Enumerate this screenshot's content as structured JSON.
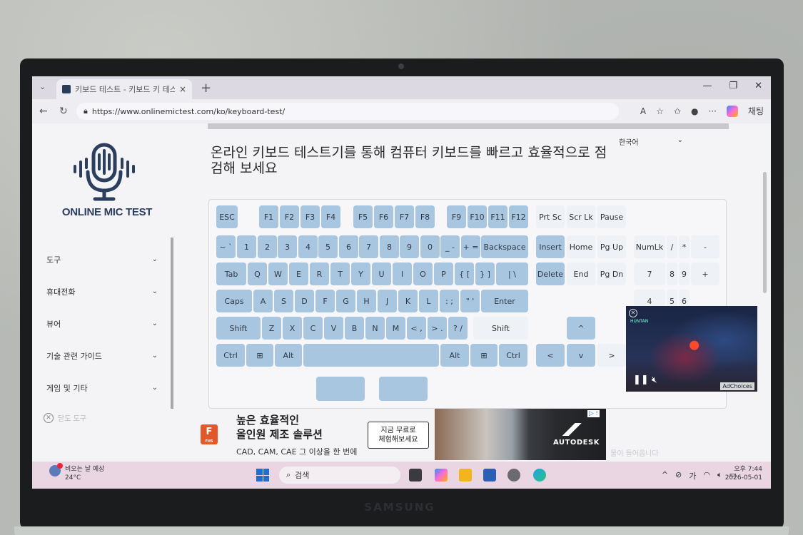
{
  "browser": {
    "tab_title": "키보드 테스트 - 키보드 키 테스트",
    "tab_close": "×",
    "new_tab": "+",
    "url": "https://www.onlinemictest.com/ko/keyboard-test/",
    "copilot_label": "채팅"
  },
  "site": {
    "logo_text": "ONLINE MIC TEST",
    "language": "한국어",
    "headline": "온라인 키보드 테스트기를 통해 컴퓨터 키보드를 빠르고 효율적으로 점검해 보세요"
  },
  "sidebar": {
    "items": [
      {
        "label": "도구"
      },
      {
        "label": "휴대전화"
      },
      {
        "label": "뷰어"
      },
      {
        "label": "기술 관련 가이드"
      },
      {
        "label": "게임 및 기타"
      }
    ],
    "close_label": "닫도 도구"
  },
  "keyboard": {
    "keys": [
      {
        "label": "ESC",
        "row": 0
      },
      {
        "label": "F1",
        "row": 0
      },
      {
        "label": "F2",
        "row": 0
      },
      {
        "label": "F3",
        "row": 0
      },
      {
        "label": "F4",
        "row": 0
      },
      {
        "label": "F5",
        "row": 0
      },
      {
        "label": "F6",
        "row": 0
      },
      {
        "label": "F7",
        "row": 0
      },
      {
        "label": "F8",
        "row": 0
      },
      {
        "label": "F9",
        "row": 0
      },
      {
        "label": "F10",
        "row": 0
      },
      {
        "label": "F11",
        "row": 0
      },
      {
        "label": "F12",
        "row": 0
      },
      {
        "label": "Prt Sc",
        "row": 0
      },
      {
        "label": "Scr Lk",
        "row": 0
      },
      {
        "label": "Pause",
        "row": 0
      },
      {
        "label": "~ `",
        "row": 1
      },
      {
        "label": "1",
        "row": 1
      },
      {
        "label": "2",
        "row": 1
      },
      {
        "label": "3",
        "row": 1
      },
      {
        "label": "4",
        "row": 1
      },
      {
        "label": "5",
        "row": 1
      },
      {
        "label": "6",
        "row": 1
      },
      {
        "label": "7",
        "row": 1
      },
      {
        "label": "8",
        "row": 1
      },
      {
        "label": "9",
        "row": 1
      },
      {
        "label": "0",
        "row": 1
      },
      {
        "label": "_ -",
        "row": 1
      },
      {
        "label": "+ =",
        "row": 1
      },
      {
        "label": "Backspace",
        "row": 1
      },
      {
        "label": "Insert",
        "row": 1
      },
      {
        "label": "Home",
        "row": 1
      },
      {
        "label": "Pg Up",
        "row": 1
      },
      {
        "label": "NumLk",
        "row": 1
      },
      {
        "label": "/",
        "row": 1
      },
      {
        "label": "*",
        "row": 1
      },
      {
        "label": "-",
        "row": 1
      },
      {
        "label": "Tab",
        "row": 2
      },
      {
        "label": "Q",
        "row": 2
      },
      {
        "label": "W",
        "row": 2
      },
      {
        "label": "E",
        "row": 2
      },
      {
        "label": "R",
        "row": 2
      },
      {
        "label": "T",
        "row": 2
      },
      {
        "label": "Y",
        "row": 2
      },
      {
        "label": "U",
        "row": 2
      },
      {
        "label": "I",
        "row": 2
      },
      {
        "label": "O",
        "row": 2
      },
      {
        "label": "P",
        "row": 2
      },
      {
        "label": "{ [",
        "row": 2
      },
      {
        "label": "} ]",
        "row": 2
      },
      {
        "label": "| \\",
        "row": 2
      },
      {
        "label": "Delete",
        "row": 2
      },
      {
        "label": "End",
        "row": 2
      },
      {
        "label": "Pg Dn",
        "row": 2
      },
      {
        "label": "7",
        "row": 2
      },
      {
        "label": "8",
        "row": 2
      },
      {
        "label": "9",
        "row": 2
      },
      {
        "label": "+",
        "row": 2
      },
      {
        "label": "Caps",
        "row": 3
      },
      {
        "label": "A",
        "row": 3
      },
      {
        "label": "S",
        "row": 3
      },
      {
        "label": "D",
        "row": 3
      },
      {
        "label": "F",
        "row": 3
      },
      {
        "label": "G",
        "row": 3
      },
      {
        "label": "H",
        "row": 3
      },
      {
        "label": "J",
        "row": 3
      },
      {
        "label": "K",
        "row": 3
      },
      {
        "label": "L",
        "row": 3
      },
      {
        "label": ": ;",
        "row": 3
      },
      {
        "label": "\" '",
        "row": 3
      },
      {
        "label": "Enter",
        "row": 3
      },
      {
        "label": "4",
        "row": 3
      },
      {
        "label": "5",
        "row": 3
      },
      {
        "label": "6",
        "row": 3
      },
      {
        "label": "Shift",
        "row": 4
      },
      {
        "label": "Z",
        "row": 4
      },
      {
        "label": "X",
        "row": 4
      },
      {
        "label": "C",
        "row": 4
      },
      {
        "label": "V",
        "row": 4
      },
      {
        "label": "B",
        "row": 4
      },
      {
        "label": "N",
        "row": 4
      },
      {
        "label": "M",
        "row": 4
      },
      {
        "label": "< ,",
        "row": 4
      },
      {
        "label": "> .",
        "row": 4
      },
      {
        "label": "? /",
        "row": 4
      },
      {
        "label": "Shift",
        "row": 4
      },
      {
        "label": "^",
        "row": 4
      },
      {
        "label": "Ctrl",
        "row": 5
      },
      {
        "label": "⊞",
        "row": 5
      },
      {
        "label": "Alt",
        "row": 5
      },
      {
        "label": "",
        "row": 5
      },
      {
        "label": "Alt",
        "row": 5
      },
      {
        "label": "⊞",
        "row": 5
      },
      {
        "label": "Ctrl",
        "row": 5
      },
      {
        "label": "<",
        "row": 5
      },
      {
        "label": "v",
        "row": 5
      },
      {
        "label": ">",
        "row": 5
      }
    ]
  },
  "video_ad": {
    "channel": "HUNTAN",
    "adchoices": "AdChoices"
  },
  "ad": {
    "logo_letter": "F",
    "logo_sub": "FUS",
    "headline_line1": "높은 효율적인",
    "headline_line2": "올인원 제조 솔루션",
    "subtext": "CAD, CAM, CAE 그 이상을 한 번에",
    "cta_line1": "지금 무료로",
    "cta_line2": "체험해보세요",
    "brand": "AUTODESK",
    "adchoices_marker": "▷ ⁝"
  },
  "faint_text": "물이 들어옵니다",
  "taskbar": {
    "weather_line1": "비오는 날 예상",
    "weather_line2": "24°C",
    "search_label": "검색",
    "ime": "가",
    "time": "오후 7:44",
    "date": "2026-05-01"
  },
  "device_brand": "SAMSUNG",
  "colors": {
    "key": "#a9c6e0",
    "logo": "#2c3e5d",
    "taskbar": "#e9d6e2"
  }
}
